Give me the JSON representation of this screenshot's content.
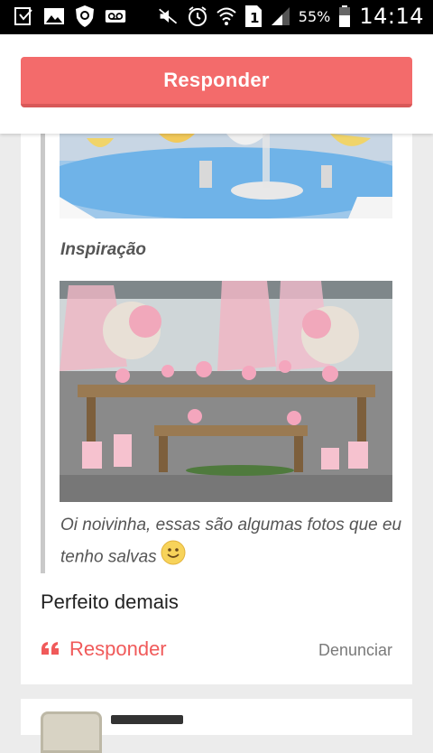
{
  "status_bar": {
    "battery_percent": "55%",
    "time": "14:14",
    "sim_label": "1"
  },
  "header": {
    "respond_button": "Responder"
  },
  "post": {
    "inspiration_label": "Inspiração",
    "quote_text": "Oi noivinha, essas são algumas fotos que eu tenho salvas",
    "comment_text": "Perfeito demais",
    "reply_label": "Responder",
    "report_label": "Denunciar"
  },
  "colors": {
    "accent": "#f36b6b",
    "accent_text": "#f05a5a"
  }
}
